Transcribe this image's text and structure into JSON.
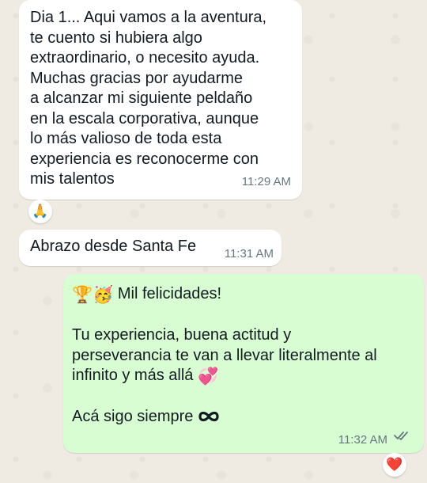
{
  "messages": [
    {
      "direction": "incoming",
      "text": "Dia 1... Aqui vamos a la aventura,\nte cuento si hubiera algo\nextraordinario, o necesito ayuda.\nMuchas gracias por ayudarme\na alcanzar mi siguiente peldaño\nen la escala corporativa, aunque\nlo más valioso de toda esta\nexperiencia es reconocerme con\nmis talentos",
      "time": "11:29 AM",
      "reaction": "🙏"
    },
    {
      "direction": "incoming",
      "text": "Abrazo desde Santa Fe",
      "time": "11:31 AM"
    },
    {
      "direction": "outgoing",
      "line1_emoji": "🏆🥳",
      "line1_text": "Mil felicidades!",
      "paragraph2": "Tu experiencia, buena actitud y\nperseverancia te van a llevar literalmente al\ninfinito y más allá",
      "paragraph2_emoji": "💞",
      "line3_text": "Acá sigo siempre",
      "line3_emoji": "♾",
      "time": "11:32 AM",
      "status": "read-double-check-icon",
      "reaction": "❤️"
    }
  ],
  "colors": {
    "background": "#efeae2",
    "incoming_bubble": "#ffffff",
    "outgoing_bubble": "#d9fdd3",
    "text": "#111b21",
    "meta": "#667781"
  }
}
